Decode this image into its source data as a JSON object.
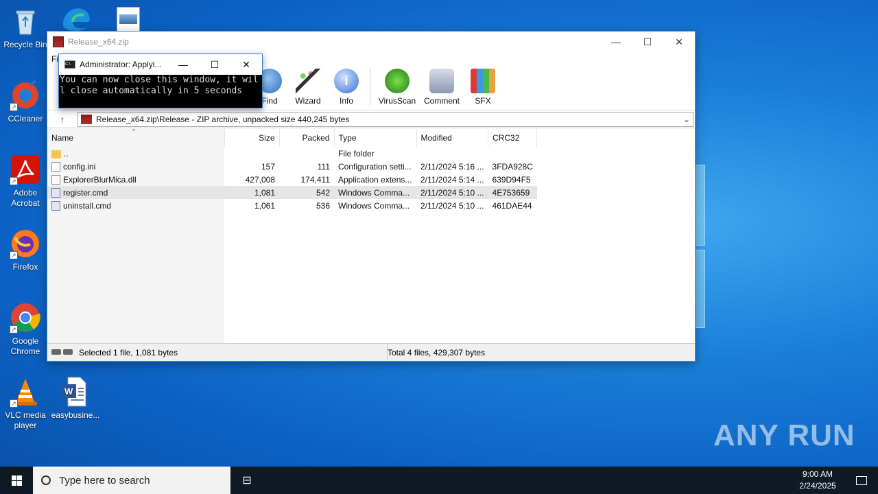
{
  "desktop": {
    "icons": [
      {
        "label": "Recycle Bin"
      },
      {
        "label": "CCleaner"
      },
      {
        "label": "Adobe Acrobat"
      },
      {
        "label": "Firefox"
      },
      {
        "label": "Google Chrome"
      },
      {
        "label": "VLC media player"
      },
      {
        "label": "easybusine..."
      }
    ],
    "watermark": "ANY RUN"
  },
  "winrar": {
    "title": "Release_x64.zip",
    "menu_first": "Fi",
    "toolbar": [
      "Find",
      "Wizard",
      "Info",
      "VirusScan",
      "Comment",
      "SFX"
    ],
    "path": "Release_x64.zip\\Release - ZIP archive, unpacked size 440,245 bytes",
    "columns": [
      "Name",
      "Size",
      "Packed",
      "Type",
      "Modified",
      "CRC32"
    ],
    "rows": [
      {
        "name": "..",
        "size": "",
        "packed": "",
        "type": "File folder",
        "modified": "",
        "crc": ""
      },
      {
        "name": "config.ini",
        "size": "157",
        "packed": "111",
        "type": "Configuration setti...",
        "modified": "2/11/2024 5:16 ...",
        "crc": "3FDA928C"
      },
      {
        "name": "ExplorerBlurMica.dll",
        "size": "427,008",
        "packed": "174,411",
        "type": "Application extens...",
        "modified": "2/11/2024 5:14 ...",
        "crc": "639D94F5"
      },
      {
        "name": "register.cmd",
        "size": "1,081",
        "packed": "542",
        "type": "Windows Comma...",
        "modified": "2/11/2024 5:10 ...",
        "crc": "4E753659"
      },
      {
        "name": "uninstall.cmd",
        "size": "1,061",
        "packed": "536",
        "type": "Windows Comma...",
        "modified": "2/11/2024 5:10 ...",
        "crc": "461DAE44"
      }
    ],
    "status_left": "Selected 1 file, 1,081 bytes",
    "status_right": "Total 4 files, 429,307 bytes"
  },
  "console": {
    "title": "Administrator:  Applyi...",
    "text": "You can now close this window, it will close automatically in 5 seconds"
  },
  "taskbar": {
    "search_placeholder": "Type here to search",
    "time": "9:00 AM",
    "date": "2/24/2025"
  }
}
